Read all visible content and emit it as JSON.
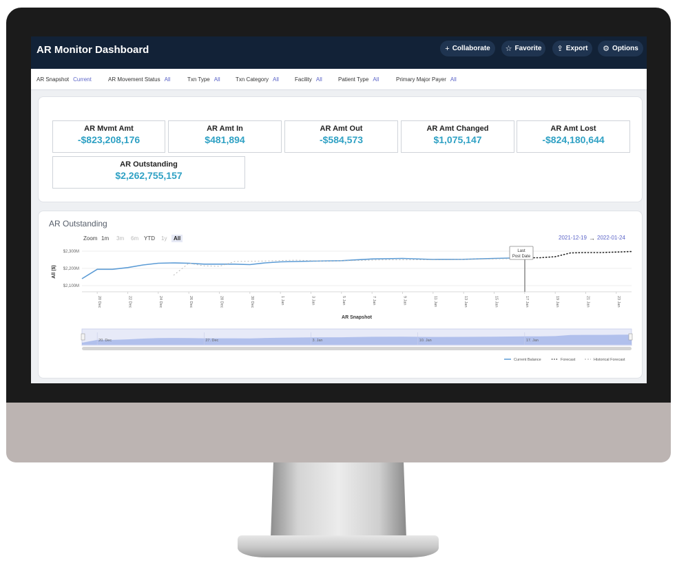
{
  "header": {
    "title": "AR Monitor Dashboard",
    "buttons": {
      "collaborate": "Collaborate",
      "favorite": "Favorite",
      "export": "Export",
      "options": "Options"
    }
  },
  "filters": [
    {
      "label": "AR Snapshot",
      "value": "Current"
    },
    {
      "label": "AR Movement Status",
      "value": "All"
    },
    {
      "label": "Txn Type",
      "value": "All"
    },
    {
      "label": "Txn Category",
      "value": "All"
    },
    {
      "label": "Facility",
      "value": "All"
    },
    {
      "label": "Patient Type",
      "value": "All"
    },
    {
      "label": "Primary Major Payer",
      "value": "All"
    }
  ],
  "kpis": [
    {
      "label": "AR Mvmt Amt",
      "value": "-$823,208,176"
    },
    {
      "label": "AR Amt In",
      "value": "$481,894"
    },
    {
      "label": "AR Amt Out",
      "value": "-$584,573"
    },
    {
      "label": "AR Amt Changed",
      "value": "$1,075,147"
    },
    {
      "label": "AR Amt Lost",
      "value": "-$824,180,644"
    },
    {
      "label": "AR Outstanding",
      "value": "$2,262,755,157"
    }
  ],
  "chart": {
    "title": "AR Outstanding",
    "zoom_label": "Zoom",
    "zoom_options": [
      "1m",
      "3m",
      "6m",
      "YTD",
      "1y",
      "All"
    ],
    "zoom_selected": "All",
    "range_from": "2021-12-19",
    "range_arrow": "→",
    "range_to": "2022-01-24",
    "annotation_line1": "Last",
    "annotation_line2": "Post Date",
    "navigator_labels": [
      "20. Dec",
      "27. Dec",
      "3. Jan",
      "10. Jan",
      "17. Jan"
    ]
  },
  "chart_data": {
    "type": "line",
    "title": "AR Outstanding",
    "xlabel": "AR Snapshot",
    "ylabel": "All ($)",
    "y_ticks": [
      "$2,100M",
      "$2,200M",
      "$2,300M"
    ],
    "ylim": [
      2100,
      2340
    ],
    "x_ticks": [
      "20 Dec",
      "22 Dec",
      "24 Dec",
      "26 Dec",
      "28 Dec",
      "30 Dec",
      "1 Jan",
      "3 Jan",
      "5 Jan",
      "7 Jan",
      "9 Jan",
      "11 Jan",
      "13 Jan",
      "15 Jan",
      "17 Jan",
      "19 Jan",
      "21 Jan",
      "23 Jan"
    ],
    "legend": [
      "Current Balance",
      "Forecast",
      "Historical Forecast"
    ],
    "legend_position": "bottom-right",
    "series": [
      {
        "name": "Current Balance",
        "style": "solid",
        "color": "#5b9bd5",
        "x": [
          "2021-12-19",
          "2021-12-20",
          "2021-12-21",
          "2021-12-22",
          "2021-12-23",
          "2021-12-24",
          "2021-12-25",
          "2021-12-26",
          "2021-12-27",
          "2021-12-28",
          "2021-12-29",
          "2021-12-30",
          "2021-12-31",
          "2022-01-01",
          "2022-01-03",
          "2022-01-05",
          "2022-01-07",
          "2022-01-09",
          "2022-01-11",
          "2022-01-13",
          "2022-01-15",
          "2022-01-17"
        ],
        "y": [
          2140,
          2195,
          2195,
          2205,
          2220,
          2230,
          2232,
          2230,
          2225,
          2225,
          2225,
          2222,
          2232,
          2238,
          2242,
          2245,
          2255,
          2258,
          2252,
          2253,
          2258,
          2262
        ]
      },
      {
        "name": "Forecast",
        "style": "dotted",
        "color": "#222222",
        "x": [
          "2022-01-17",
          "2022-01-18",
          "2022-01-19",
          "2022-01-20",
          "2022-01-21",
          "2022-01-22",
          "2022-01-23",
          "2022-01-24"
        ],
        "y": [
          2262,
          2262,
          2268,
          2290,
          2292,
          2292,
          2295,
          2298
        ]
      },
      {
        "name": "Historical Forecast",
        "style": "dashed",
        "color": "#b8b8b8",
        "x": [
          "2021-12-25",
          "2021-12-26",
          "2021-12-27",
          "2021-12-28",
          "2021-12-29",
          "2021-12-31",
          "2022-01-02",
          "2022-01-04",
          "2022-01-08",
          "2022-01-12",
          "2022-01-17"
        ],
        "y": [
          2160,
          2230,
          2215,
          2212,
          2240,
          2243,
          2248,
          2242,
          2250,
          2250,
          2258
        ]
      }
    ]
  }
}
